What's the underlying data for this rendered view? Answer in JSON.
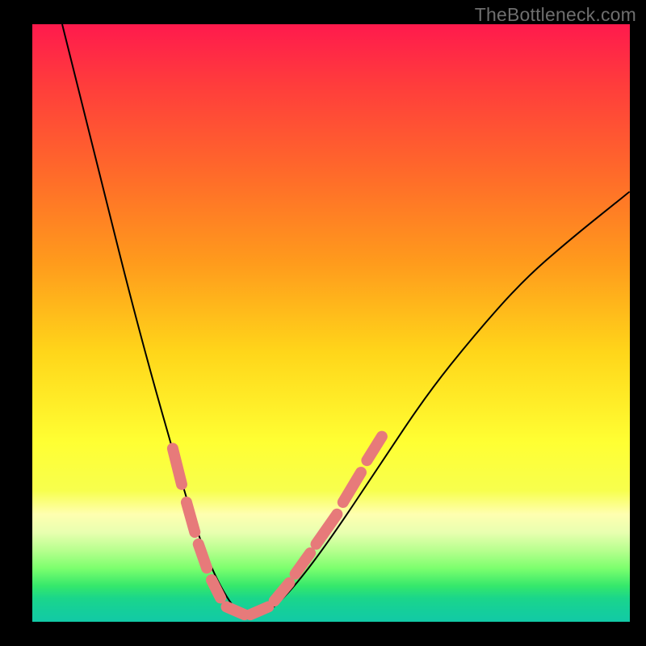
{
  "watermark": "TheBottleneck.com",
  "chart_data": {
    "type": "line",
    "title": "",
    "xlabel": "",
    "ylabel": "",
    "xlim": [
      0,
      100
    ],
    "ylim": [
      0,
      100
    ],
    "grid": false,
    "series": [
      {
        "name": "bottleneck-curve",
        "x": [
          5,
          8,
          12,
          16,
          20,
          24,
          26,
          28,
          30,
          32,
          34,
          36,
          38,
          40,
          44,
          50,
          58,
          66,
          74,
          82,
          90,
          100
        ],
        "y": [
          100,
          88,
          72,
          56,
          41,
          27,
          20,
          14,
          9,
          5,
          2,
          1,
          1,
          2,
          6,
          14,
          26,
          38,
          48,
          57,
          64,
          72
        ],
        "color": "#000000"
      }
    ],
    "markers": [
      {
        "name": "highlight-dashes",
        "color": "#e77a7a",
        "segments": [
          {
            "x1": 23.5,
            "y1": 29,
            "x2": 25.0,
            "y2": 23
          },
          {
            "x1": 25.8,
            "y1": 20,
            "x2": 27.2,
            "y2": 15
          },
          {
            "x1": 27.8,
            "y1": 13,
            "x2": 29.2,
            "y2": 9
          },
          {
            "x1": 30.0,
            "y1": 7,
            "x2": 31.5,
            "y2": 4
          },
          {
            "x1": 32.5,
            "y1": 2.5,
            "x2": 35.5,
            "y2": 1.2
          },
          {
            "x1": 36.5,
            "y1": 1.2,
            "x2": 39.5,
            "y2": 2.5
          },
          {
            "x1": 40.5,
            "y1": 3.5,
            "x2": 43.0,
            "y2": 6.5
          },
          {
            "x1": 44.0,
            "y1": 8.0,
            "x2": 46.5,
            "y2": 11.5
          },
          {
            "x1": 47.5,
            "y1": 13,
            "x2": 51.0,
            "y2": 18
          },
          {
            "x1": 52.0,
            "y1": 20,
            "x2": 55.0,
            "y2": 25
          },
          {
            "x1": 56.0,
            "y1": 27,
            "x2": 58.5,
            "y2": 31
          }
        ]
      }
    ]
  }
}
